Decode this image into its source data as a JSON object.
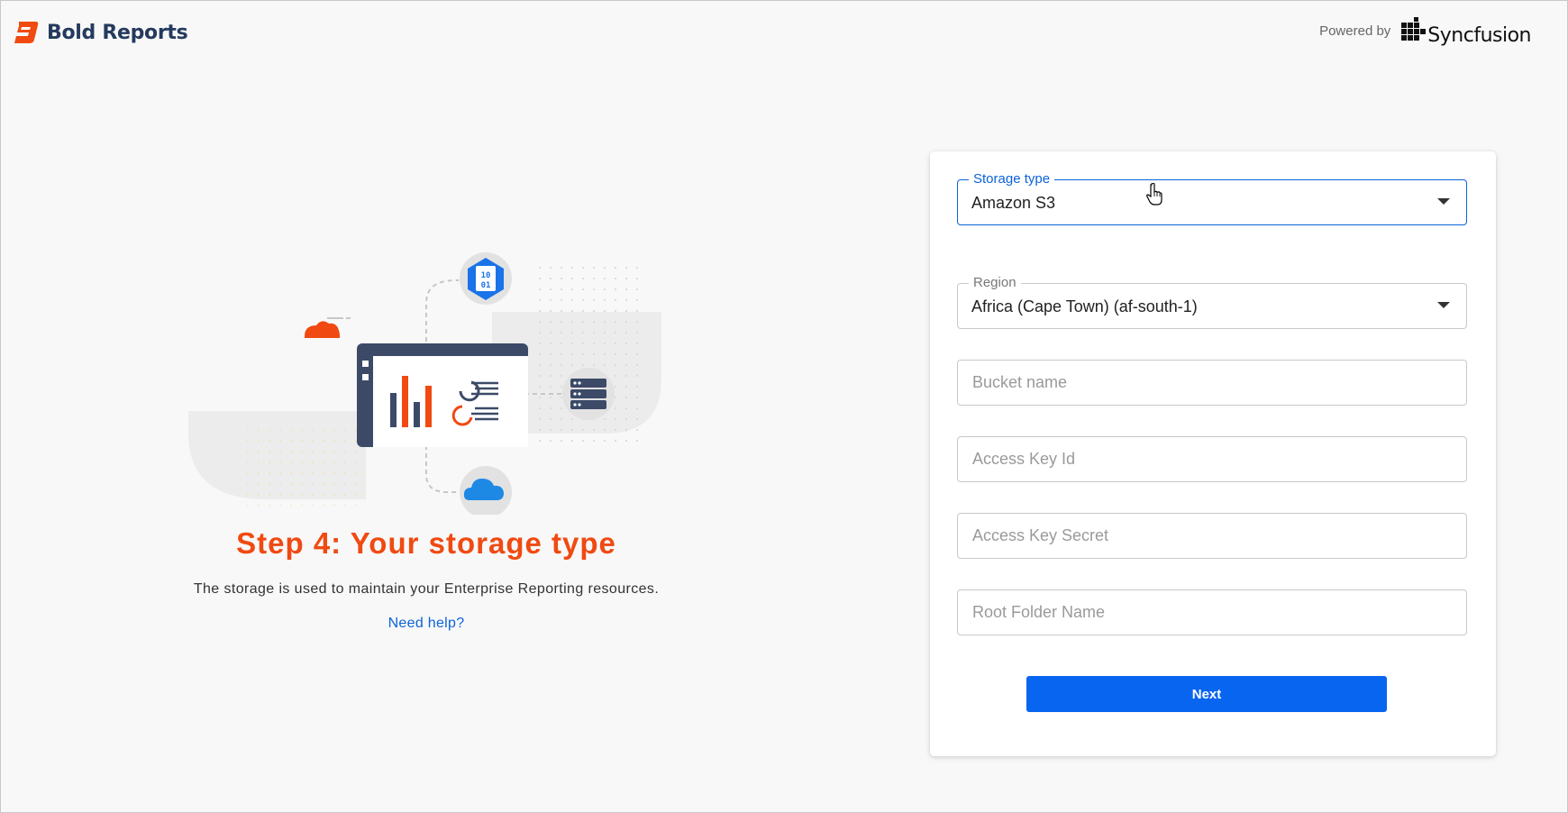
{
  "header": {
    "brand_name": "Bold Reports",
    "powered_label": "Powered by",
    "partner_name": "Syncfusion",
    "brand_color": "#f04a12",
    "brand_text_color": "#243a5e"
  },
  "hero": {
    "title": "Step 4: Your storage type",
    "description": "The storage is used to maintain your Enterprise Reporting resources.",
    "help_link": "Need help?",
    "illustration_icons": [
      "binary-file-icon",
      "database-server-icon",
      "cloud-icon",
      "report-dashboard-icon"
    ]
  },
  "form": {
    "storage_type": {
      "label": "Storage type",
      "value": "Amazon S3"
    },
    "region": {
      "label": "Region",
      "value": "Africa (Cape Town) (af-south-1)"
    },
    "bucket_name": {
      "placeholder": "Bucket name",
      "value": ""
    },
    "access_key_id": {
      "placeholder": "Access Key Id",
      "value": ""
    },
    "access_key_secret": {
      "placeholder": "Access Key Secret",
      "value": ""
    },
    "root_folder_name": {
      "placeholder": "Root Folder Name",
      "value": ""
    },
    "next_label": "Next",
    "accent_color": "#0865f0"
  }
}
